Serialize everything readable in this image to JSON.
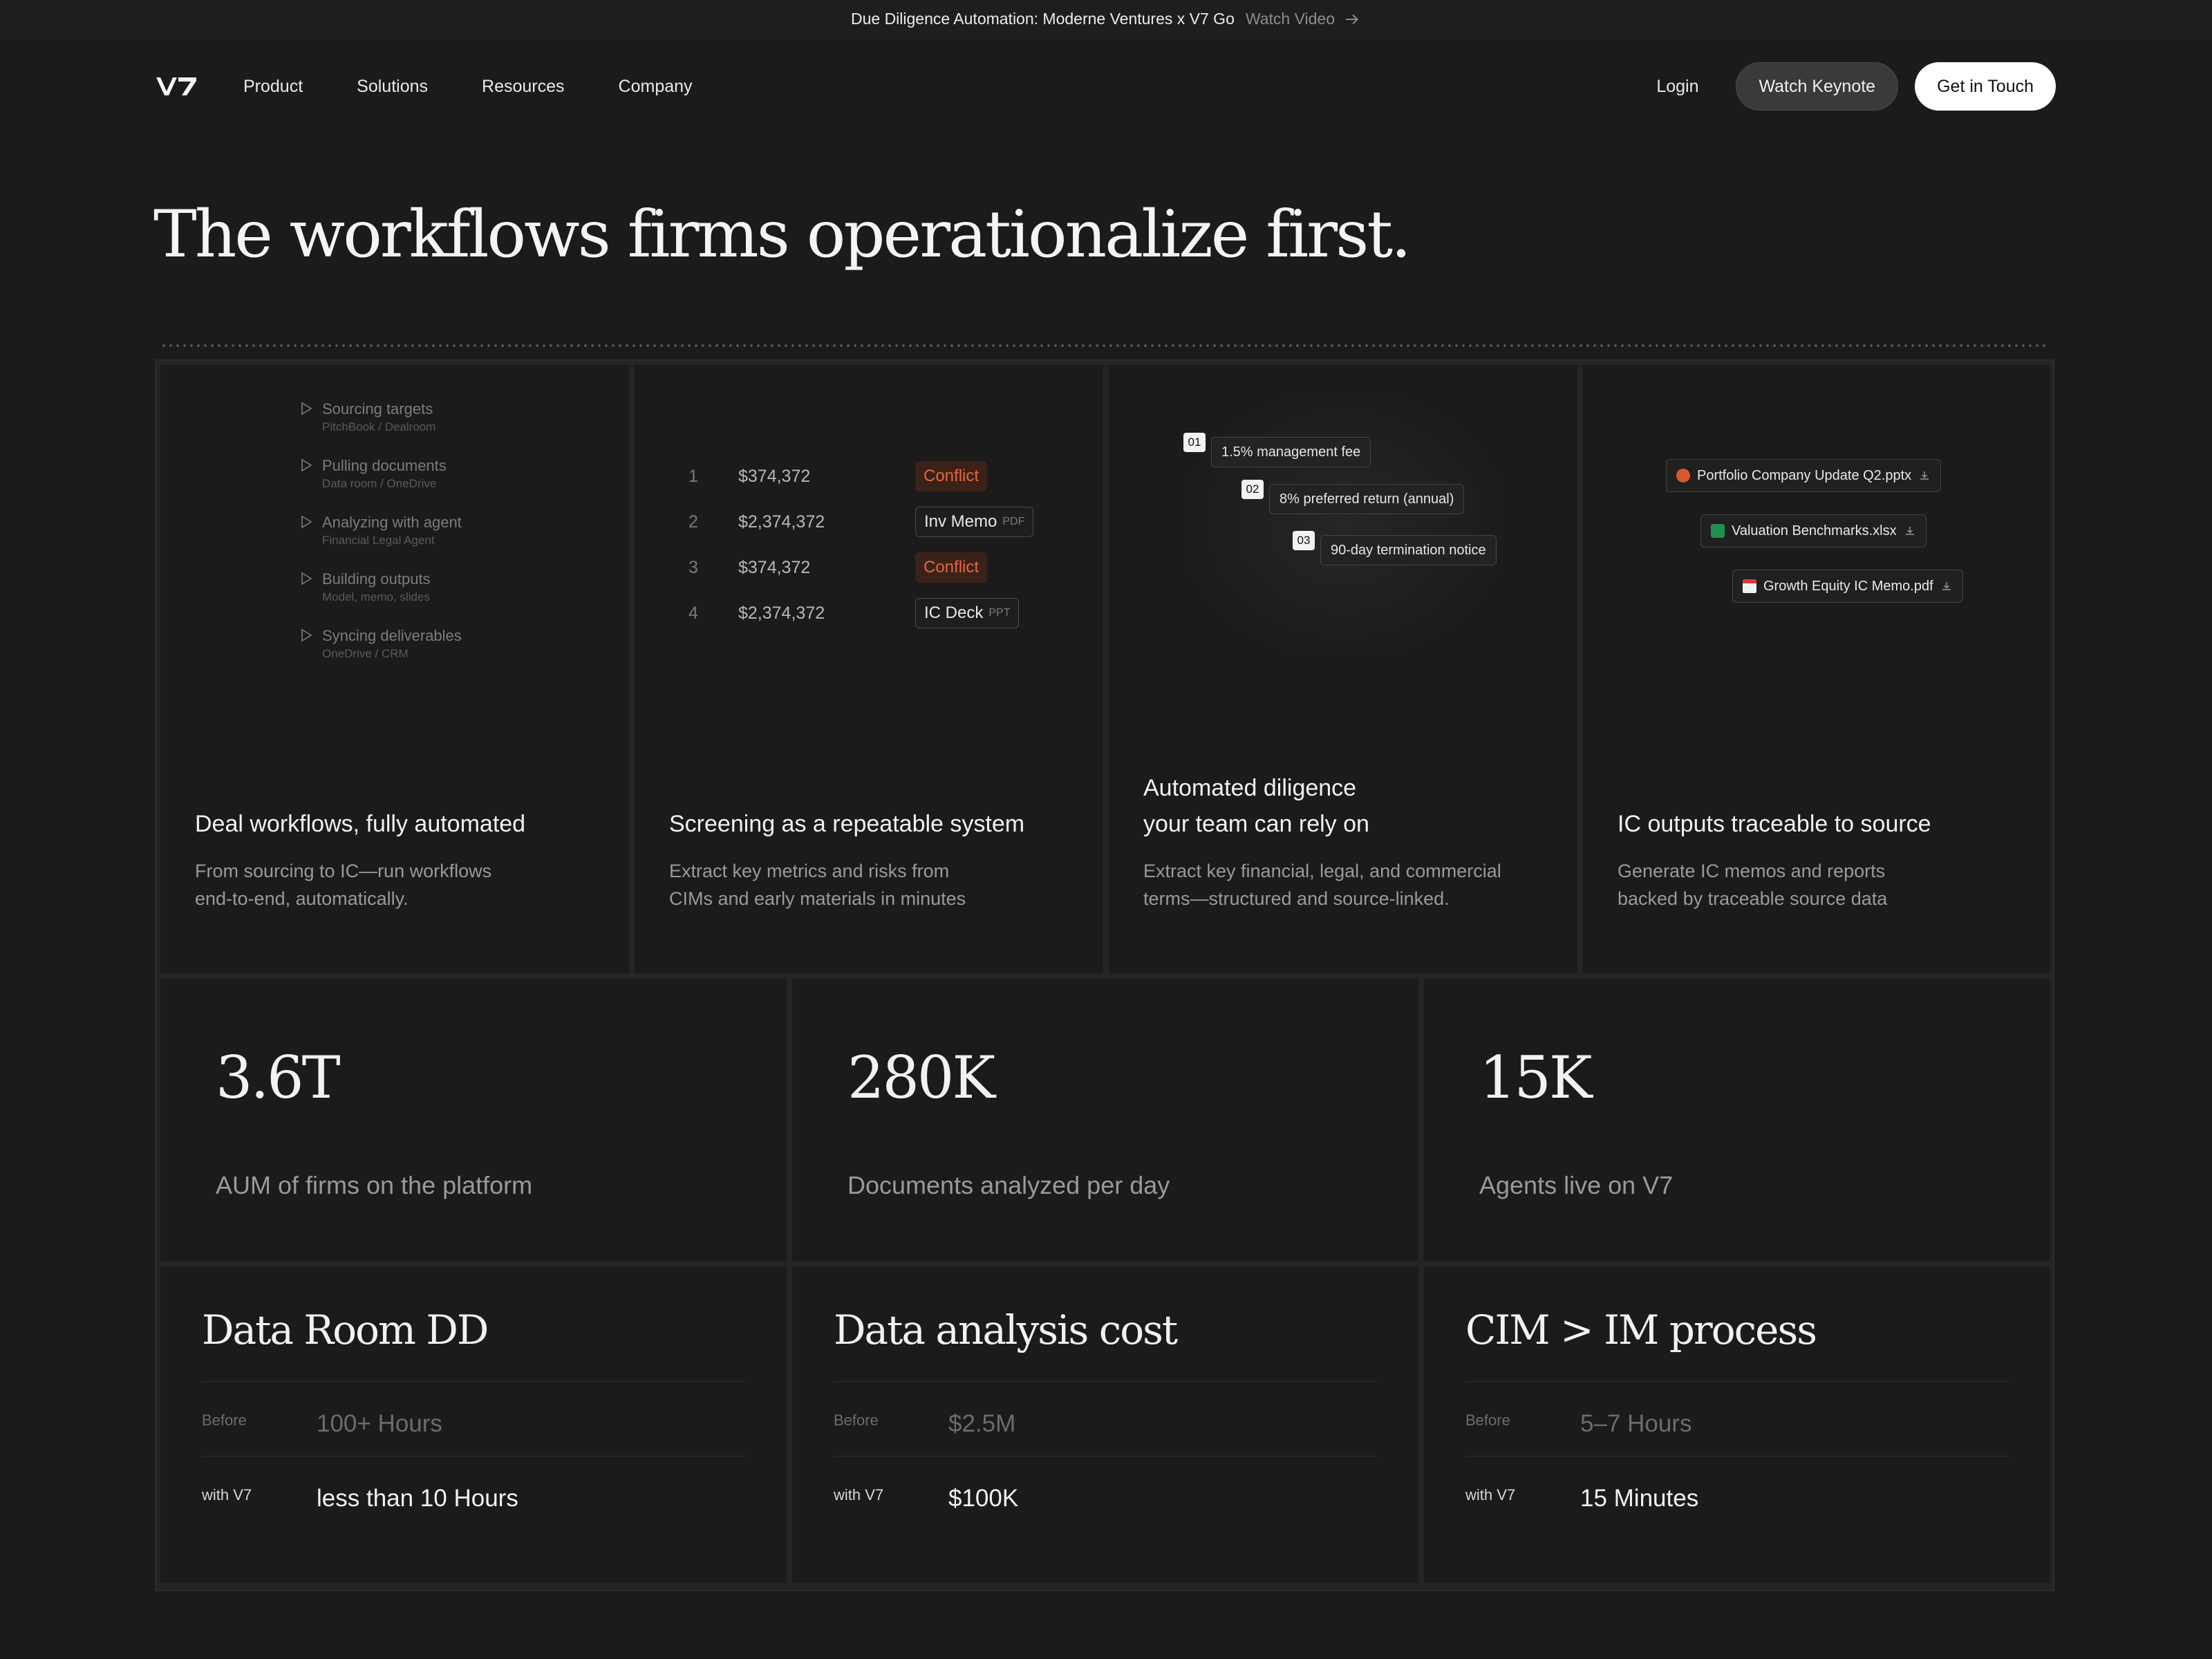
{
  "announcement": {
    "text": "Due Diligence Automation: Moderne Ventures x V7 Go",
    "link": "Watch Video",
    "icon": "arrow-right-icon"
  },
  "nav": {
    "logo": "V7",
    "links": [
      "Product",
      "Solutions",
      "Resources",
      "Company"
    ],
    "login": "Login",
    "keynote": "Watch Keynote",
    "contact": "Get in Touch"
  },
  "hero": {
    "title": "The workflows firms operationalize first."
  },
  "cards": [
    {
      "title": "Deal workflows, fully automated",
      "desc1": "From sourcing to IC—run workflows",
      "desc2": "end-to-end, automatically.",
      "steps": [
        {
          "title": "Sourcing targets",
          "sub": "PitchBook / Dealroom"
        },
        {
          "title": "Pulling documents",
          "sub": "Data room / OneDrive"
        },
        {
          "title": "Analyzing with agent",
          "sub": "Financial Legal Agent"
        },
        {
          "title": "Building outputs",
          "sub": "Model, memo, slides"
        },
        {
          "title": "Syncing deliverables",
          "sub": "OneDrive / CRM"
        }
      ]
    },
    {
      "title": "Screening as a repeatable system",
      "desc1": "Extract key metrics and risks from",
      "desc2": "CIMs and early materials in minutes",
      "rows": [
        {
          "n": "1",
          "amount": "$374,372",
          "tag": "Conflict",
          "kind": ""
        },
        {
          "n": "2",
          "amount": "$2,374,372",
          "tag": "Inv Memo",
          "kind": "PDF"
        },
        {
          "n": "3",
          "amount": "$374,372",
          "tag": "Conflict",
          "kind": ""
        },
        {
          "n": "4",
          "amount": "$2,374,372",
          "tag": "IC Deck",
          "kind": "PPT"
        }
      ]
    },
    {
      "title1": "Automated diligence",
      "title2": "your team can rely on",
      "desc1": "Extract key financial, legal, and commercial",
      "desc2": "terms—structured and source-linked.",
      "terms": [
        {
          "n": "01",
          "label": "1.5% management fee"
        },
        {
          "n": "02",
          "label": "8% preferred return (annual)"
        },
        {
          "n": "03",
          "label": "90-day termination notice"
        }
      ]
    },
    {
      "title": "IC outputs traceable to source",
      "desc1": "Generate IC memos and reports",
      "desc2": "backed by traceable source data",
      "files": [
        {
          "name": "Portfolio Company Update Q2.pptx",
          "icon": "powerpoint-icon",
          "color": "#d9572b"
        },
        {
          "name": "Valuation Benchmarks.xlsx",
          "icon": "excel-icon",
          "color": "#1f8f4e"
        },
        {
          "name": "Growth Equity IC Memo.pdf",
          "icon": "pdf-icon",
          "color": "#d93a3a"
        }
      ]
    }
  ],
  "stats": [
    {
      "value": "3.6T",
      "label": "AUM of firms on the platform"
    },
    {
      "value": "280K",
      "label": "Documents analyzed per day"
    },
    {
      "value": "15K",
      "label": "Agents live on V7"
    }
  ],
  "comparisons": [
    {
      "title": "Data Room DD",
      "before_label": "Before",
      "before": "100+ Hours",
      "with_label": "with V7",
      "with": "less than 10 Hours"
    },
    {
      "title": "Data analysis cost",
      "before_label": "Before",
      "before": "$2.5M",
      "with_label": "with V7",
      "with": "$100K"
    },
    {
      "title": "CIM > IM process",
      "before_label": "Before",
      "before": "5–7 Hours",
      "with_label": "with V7",
      "with": "15 Minutes"
    }
  ],
  "colors": {
    "background": "#1b1b1b",
    "conflict": "#e8663c",
    "primary_button": "#ffffff"
  }
}
